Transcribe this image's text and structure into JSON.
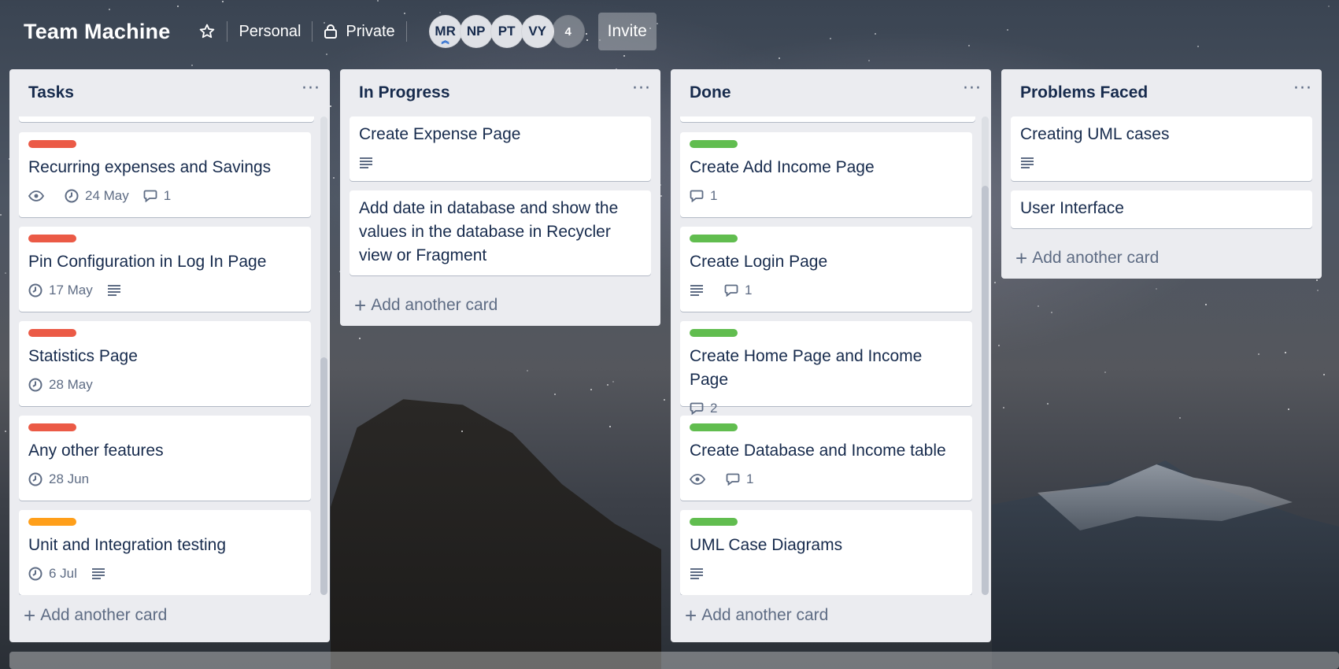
{
  "board": {
    "title": "Team Machine",
    "visibility_workspace": "Personal",
    "visibility_privacy": "Private",
    "members": [
      "MR",
      "NP",
      "PT",
      "VY"
    ],
    "more_members": "4",
    "invite_label": "Invite"
  },
  "colors": {
    "label_red": "#eb5a46",
    "label_orange": "#ff9f1a",
    "label_green": "#61bd4f",
    "list_bg": "#ebecf0"
  },
  "lists": [
    {
      "title": "Tasks",
      "menu": "···",
      "add_card": "Add another card",
      "cards": [
        {
          "label": "red",
          "title": "Recurring expenses and Savings",
          "due": "24 May",
          "comments": "1",
          "watching": true
        },
        {
          "label": "red",
          "title": "Pin Configuration in Log In Page",
          "due": "17 May",
          "description": true
        },
        {
          "label": "red",
          "title": "Statistics Page",
          "due": "28 May"
        },
        {
          "label": "red",
          "title": "Any other features",
          "due": "28 Jun"
        },
        {
          "label": "orange",
          "title": "Unit and Integration testing",
          "due": "6 Jul",
          "description": true
        }
      ]
    },
    {
      "title": "In Progress",
      "menu": "···",
      "add_card": "Add another card",
      "cards": [
        {
          "title": "Create Expense Page",
          "description": true
        },
        {
          "title": "Add date in database and show the values in the database in Recycler view or Fragment"
        }
      ]
    },
    {
      "title": "Done",
      "menu": "···",
      "add_card": "Add another card",
      "cards": [
        {
          "label": "green",
          "title": "Create Add Income Page",
          "comments": "1"
        },
        {
          "label": "green",
          "title": "Create Login Page",
          "description": true,
          "comments": "1"
        },
        {
          "label": "green",
          "title": "Create Home Page and Income Page",
          "comments": "2"
        },
        {
          "label": "green",
          "title": "Create Database and Income table",
          "watching": true,
          "comments": "1"
        },
        {
          "label": "green",
          "title": "UML Case Diagrams",
          "description": true
        }
      ]
    },
    {
      "title": "Problems Faced",
      "menu": "···",
      "add_card": "Add another card",
      "cards": [
        {
          "title": "Creating UML cases",
          "description": true
        },
        {
          "title": "User Interface"
        }
      ]
    }
  ]
}
